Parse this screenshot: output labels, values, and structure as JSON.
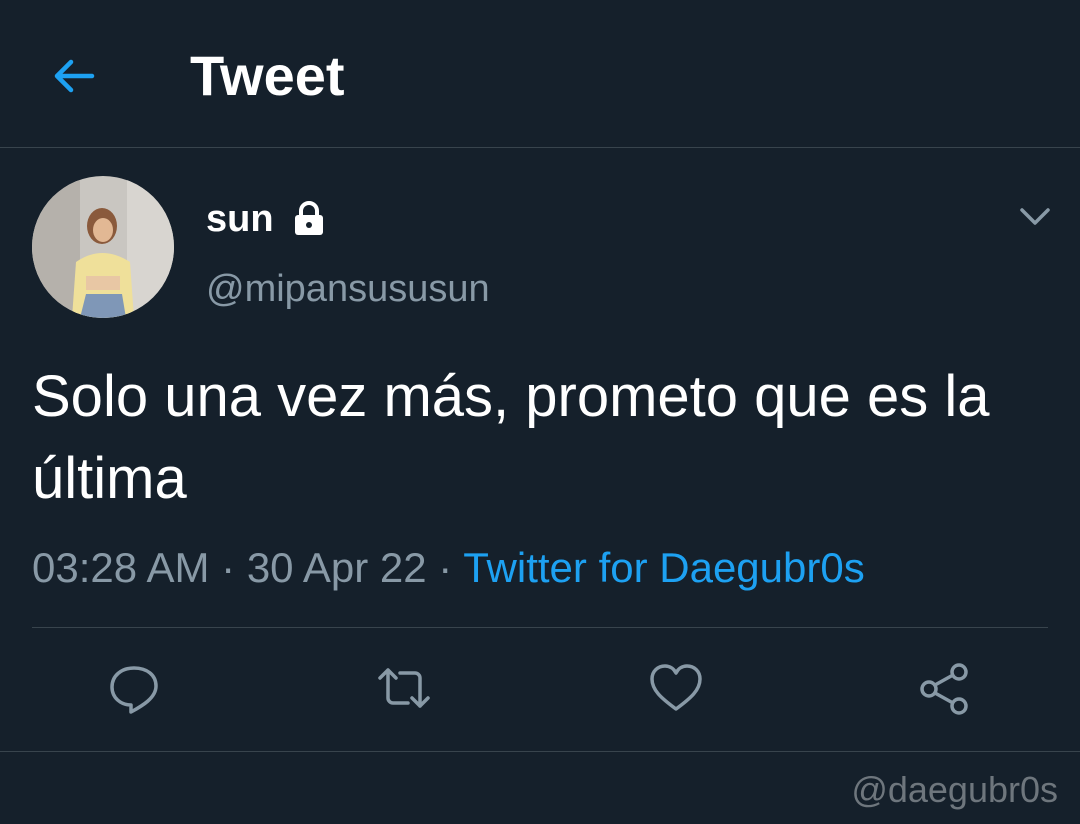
{
  "header": {
    "back_icon": "arrow-left-icon",
    "title": "Tweet"
  },
  "tweet": {
    "author": {
      "display_name": "sun",
      "protected_icon": "lock-icon",
      "handle": "@mipansususun"
    },
    "text": "Solo una vez más, prometo que es la última",
    "time": "03:28 AM",
    "date": "30 Apr 22",
    "separator": "·",
    "source": "Twitter for Daegubr0s"
  },
  "actions": [
    {
      "name": "reply",
      "icon": "speech-bubble-icon"
    },
    {
      "name": "retweet",
      "icon": "retweet-icon"
    },
    {
      "name": "like",
      "icon": "heart-icon"
    },
    {
      "name": "share",
      "icon": "share-icon"
    }
  ],
  "watermark": "@daegubr0s",
  "colors": {
    "background": "#15202b",
    "accent": "#1da1f2",
    "secondary_text": "#8899a6",
    "divider": "#38444d"
  }
}
